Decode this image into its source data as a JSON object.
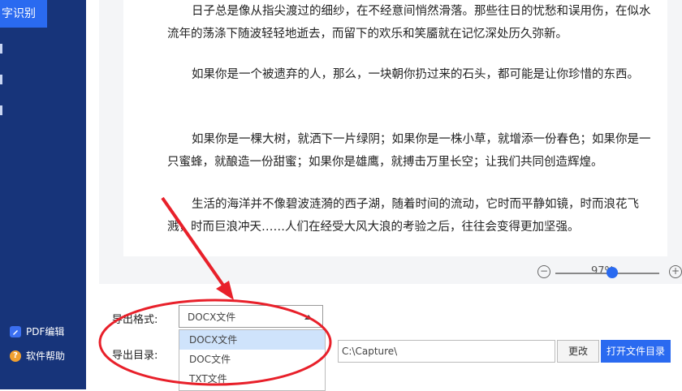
{
  "sidebar": {
    "active_item": "字识别",
    "pdf_edit": "PDF编辑",
    "help": "软件帮助"
  },
  "document": {
    "paragraphs": [
      "日子总是像从指尖渡过的细纱，在不经意间悄然滑落。那些往日的忧愁和误用伤，在似水流年的荡涤下随波轻轻地逝去，而留下的欢乐和笑靥就在记忆深处历久弥新。",
      "如果你是一个被遗弃的人，那么，一块朝你扔过来的石头，都可能是让你珍惜的东西。",
      "如果你是一棵大树，就洒下一片绿阴；如果你是一株小草，就增添一份春色；如果你是一只蜜蜂，就酿造一份甜蜜；如果你是雄鹰，就搏击万里长空；让我们共同创造辉煌。",
      "生活的海洋并不像碧波涟漪的西子湖，随着时间的流动，它时而平静如镜，时而浪花飞溅，时而巨浪冲天……人们在经受大风大浪的考验之后，往往会变得更加坚强。"
    ]
  },
  "zoom": {
    "percent_label": "97%",
    "level": 0.55,
    "minus": "−",
    "plus": "+"
  },
  "export": {
    "format_label": "导出格式:",
    "format_value": "DOCX文件",
    "options": [
      "DOCX文件",
      "DOC文件",
      "TXT文件"
    ],
    "dir_label": "导出目录:",
    "dir_value": "C:\\Capture\\",
    "change_button": "更改",
    "open_button": "打开文件目录"
  },
  "colors": {
    "sidebar": "#17347a",
    "accent": "#2a6af0",
    "annotation": "#e8202a"
  }
}
